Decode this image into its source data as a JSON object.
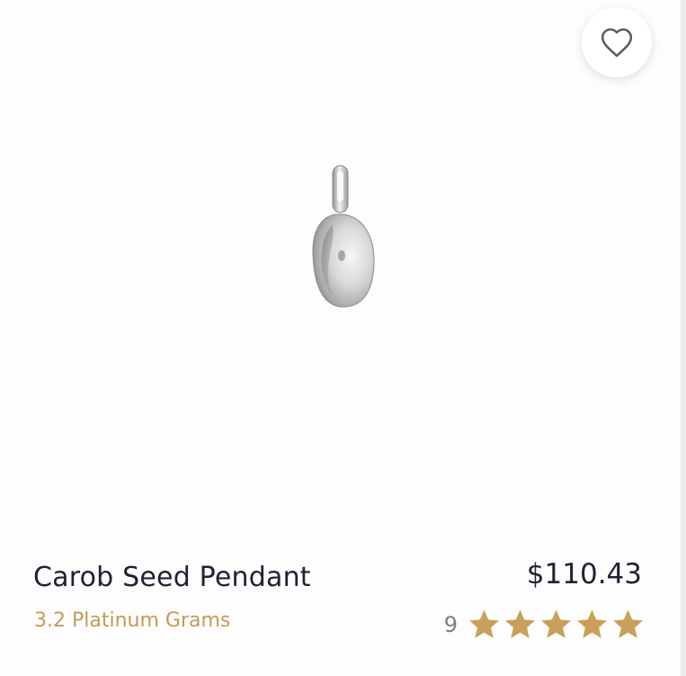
{
  "product": {
    "name": "Carob Seed Pendant",
    "weight": "3.2 Platinum Grams",
    "price": "$110.43",
    "review_count": "9",
    "rating": 5,
    "rating_max": 5,
    "image_alt": "carob-seed-pendant-image"
  },
  "favorite": {
    "icon": "heart-outline-icon",
    "active": false
  },
  "colors": {
    "text_primary": "#1e2233",
    "accent_gold": "#c49a53",
    "star_gold": "#c9a05a",
    "muted": "#7b7d86"
  }
}
